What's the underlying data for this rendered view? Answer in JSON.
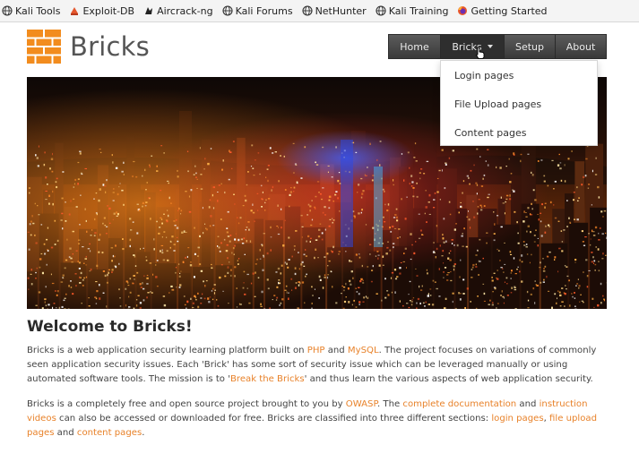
{
  "bookmarks": [
    {
      "label": "Kali Tools",
      "icon": "globe-icon"
    },
    {
      "label": "Exploit-DB",
      "icon": "exploit-db-icon"
    },
    {
      "label": "Aircrack-ng",
      "icon": "aircrack-icon"
    },
    {
      "label": "Kali Forums",
      "icon": "globe-icon"
    },
    {
      "label": "NetHunter",
      "icon": "globe-icon"
    },
    {
      "label": "Kali Training",
      "icon": "globe-icon"
    },
    {
      "label": "Getting Started",
      "icon": "firefox-icon"
    }
  ],
  "site": {
    "title": "Bricks",
    "accent_color": "#f28c1e"
  },
  "nav": {
    "home": "Home",
    "bricks": "Bricks",
    "setup": "Setup",
    "about": "About"
  },
  "dropdown": {
    "items": [
      "Login pages",
      "File Upload pages",
      "Content pages"
    ]
  },
  "content": {
    "heading": "Welcome to Bricks!",
    "p1": {
      "t1": "Bricks is a web application security learning platform built on ",
      "php": "PHP",
      "t2": " and ",
      "mysql": "MySQL",
      "t3": ". The project focuses on variations of commonly seen application security issues. Each 'Brick' has some sort of security issue which can be leveraged manually or using automated software tools. The mission is to '",
      "break": "Break the Bricks",
      "t4": "' and thus learn the various aspects of web application security."
    },
    "p2": {
      "t1": "Bricks is a completely free and open source project brought to you by ",
      "owasp": "OWASP",
      "t2": ". The ",
      "docs": "complete documentation",
      "t3": " and ",
      "videos": "instruction videos",
      "t4": " can also be accessed or downloaded for free. Bricks are classified into three different sections: ",
      "login": "login pages",
      "t5": ", ",
      "upload": "file upload pages",
      "t6": " and ",
      "contentp": "content pages",
      "t7": "."
    }
  }
}
